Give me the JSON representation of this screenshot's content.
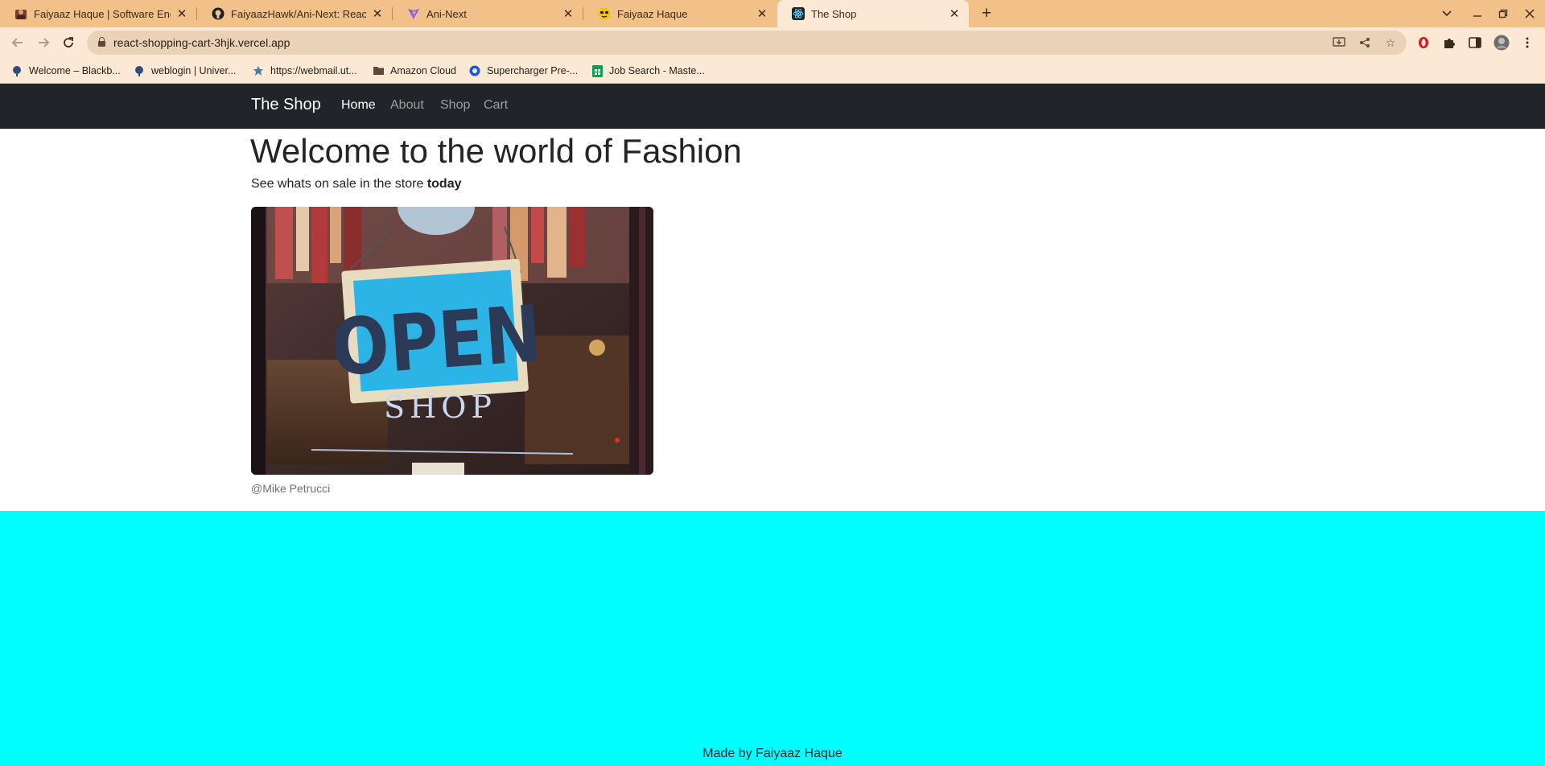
{
  "browser": {
    "tabs": [
      {
        "title": "Faiyaaz Haque | Software Engineer",
        "icon": "portfolio-favicon",
        "active": false
      },
      {
        "title": "FaiyaazHawk/Ani-Next: React from",
        "icon": "github-icon",
        "active": false
      },
      {
        "title": "Ani-Next",
        "icon": "vite-icon",
        "active": false
      },
      {
        "title": "Faiyaaz Haque",
        "icon": "emoji-favicon",
        "active": false
      },
      {
        "title": "The Shop",
        "icon": "react-icon",
        "active": true
      }
    ],
    "url": "react-shopping-cart-3hjk.vercel.app",
    "bookmarks": [
      {
        "label": "Welcome – Blackb...",
        "icon": "blackboard-icon"
      },
      {
        "label": "weblogin | Univer...",
        "icon": "university-icon"
      },
      {
        "label": "https://webmail.ut...",
        "icon": "webmail-icon"
      },
      {
        "label": "Amazon Cloud",
        "icon": "folder-icon"
      },
      {
        "label": "Supercharger Pre-...",
        "icon": "supercharger-icon"
      },
      {
        "label": "Job Search - Maste...",
        "icon": "sheets-icon"
      }
    ]
  },
  "page": {
    "brand": "The Shop",
    "nav": [
      {
        "label": "Home",
        "active": true
      },
      {
        "label": "About",
        "active": false
      },
      {
        "label": "Shop",
        "active": false
      },
      {
        "label": "Cart",
        "active": false
      }
    ],
    "heading": "Welcome to the world of Fashion",
    "lead_prefix": "See whats on sale in the store",
    "lead_emphasis": "today",
    "image_sign_text": "OPEN",
    "image_shop_text": "SHOP",
    "image_credit": "@Mike Petrucci",
    "footer_text": "Made by Faiyaaz Haque",
    "colors": {
      "navbar": "#212529",
      "footer": "#00ffff",
      "tabstrip": "#f2c089"
    }
  }
}
